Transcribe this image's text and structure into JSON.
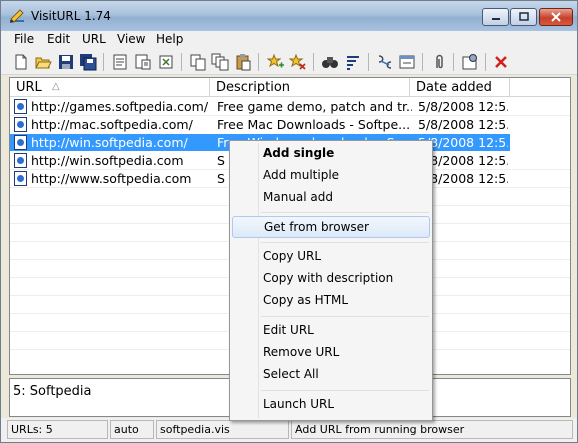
{
  "window": {
    "title": "VisitURL 1.74"
  },
  "menubar": [
    "File",
    "Edit",
    "URL",
    "View",
    "Help"
  ],
  "toolbar": {
    "icons": [
      "new-file-icon",
      "open-folder-icon",
      "save-icon",
      "save-all-icon",
      "properties-icon",
      "export-icon",
      "import-icon",
      "copy-icon",
      "copy-multiple-icon",
      "paste-icon",
      "add-star-icon",
      "remove-star-icon",
      "binoculars-icon",
      "sort-icon",
      "link-icon",
      "browser-icon",
      "attach-icon",
      "settings-icon",
      "delete-icon"
    ]
  },
  "list": {
    "columns": [
      "URL",
      "Description",
      "Date added"
    ],
    "sort_indicator": "△",
    "rows": [
      {
        "url": "http://games.softpedia.com/",
        "description": "Free game demo, patch and tr...",
        "date": "5/8/2008 12:5...",
        "selected": false
      },
      {
        "url": "http://mac.softpedia.com/",
        "description": "Free Mac Downloads - Softpe...",
        "date": "5/8/2008 12:5...",
        "selected": false
      },
      {
        "url": "http://win.softpedia.com/",
        "description": "Free Windows downloads - So...",
        "date": "5/8/2008 12:5...",
        "selected": true
      },
      {
        "url": "http://win.softpedia.com",
        "description": "S",
        "date": "5/8/2008 12:5...",
        "selected": false
      },
      {
        "url": "http://www.softpedia.com",
        "description": "S",
        "date": "5/8/2008 12:5...",
        "selected": false
      }
    ]
  },
  "notes": {
    "text": "5: Softpedia"
  },
  "statusbar": {
    "count": "URLs: 5",
    "mode": "auto",
    "file": "softpedia.vis",
    "hint": "Add URL from running browser"
  },
  "context_menu": {
    "groups": [
      [
        "Add single",
        "Add multiple",
        "Manual add"
      ],
      [
        "Get from browser"
      ],
      [
        "Copy URL",
        "Copy with description",
        "Copy as HTML"
      ],
      [
        "Edit URL",
        "Remove URL",
        "Select All"
      ],
      [
        "Launch URL"
      ]
    ],
    "default_item": "Add single",
    "hovered_item": "Get from browser"
  },
  "colors": {
    "selection": "#3399ff",
    "menu_hover": "#dde9f8",
    "title_gradient": "#a9c1dc"
  }
}
